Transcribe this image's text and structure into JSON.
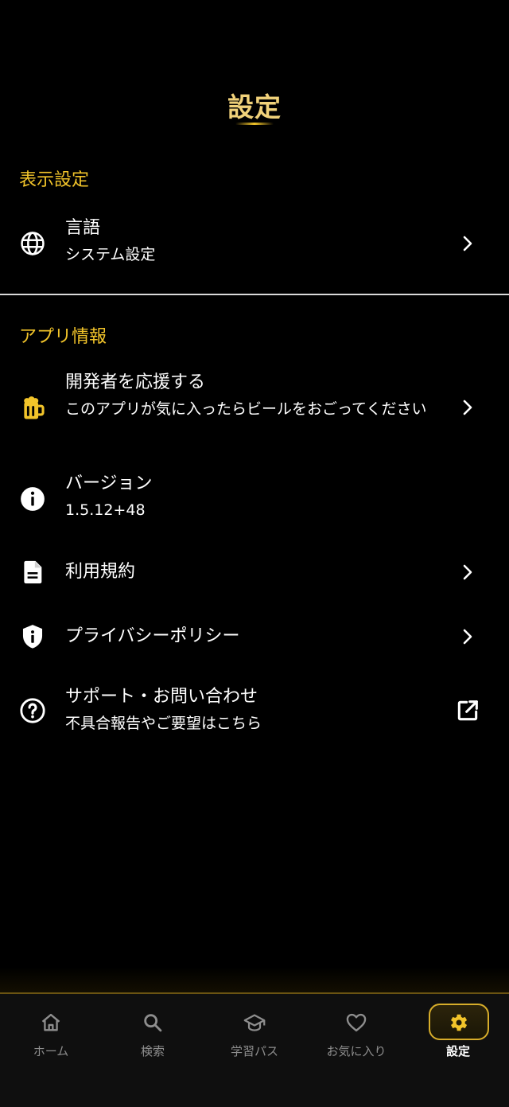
{
  "header": {
    "title": "設定"
  },
  "sections": {
    "display": {
      "title": "表示設定",
      "language": {
        "title": "言語",
        "subtitle": "システム設定",
        "icon": "globe-icon"
      }
    },
    "app_info": {
      "title": "アプリ情報",
      "support_dev": {
        "title": "開発者を応援する",
        "subtitle": "このアプリが気に入ったらビールをおごってください",
        "icon": "beer-icon"
      },
      "version": {
        "title": "バージョン",
        "value": "1.5.12+48",
        "icon": "info-icon"
      },
      "terms": {
        "title": "利用規約",
        "icon": "document-icon"
      },
      "privacy": {
        "title": "プライバシーポリシー",
        "icon": "shield-info-icon"
      },
      "support": {
        "title": "サポート・お問い合わせ",
        "subtitle": "不具合報告やご要望はこちら",
        "icon": "help-circle-icon"
      }
    }
  },
  "bottom_nav": {
    "items": [
      {
        "label": "ホーム",
        "icon": "home-icon"
      },
      {
        "label": "検索",
        "icon": "search-icon"
      },
      {
        "label": "学習パス",
        "icon": "graduation-cap-icon"
      },
      {
        "label": "お気に入り",
        "icon": "heart-icon"
      },
      {
        "label": "設定",
        "icon": "gear-icon"
      }
    ],
    "active_index": 4
  },
  "colors": {
    "accent": "#f2c42a",
    "background": "#000000",
    "nav_inactive": "#8e8e8e",
    "nav_background": "#0f0f0f"
  }
}
